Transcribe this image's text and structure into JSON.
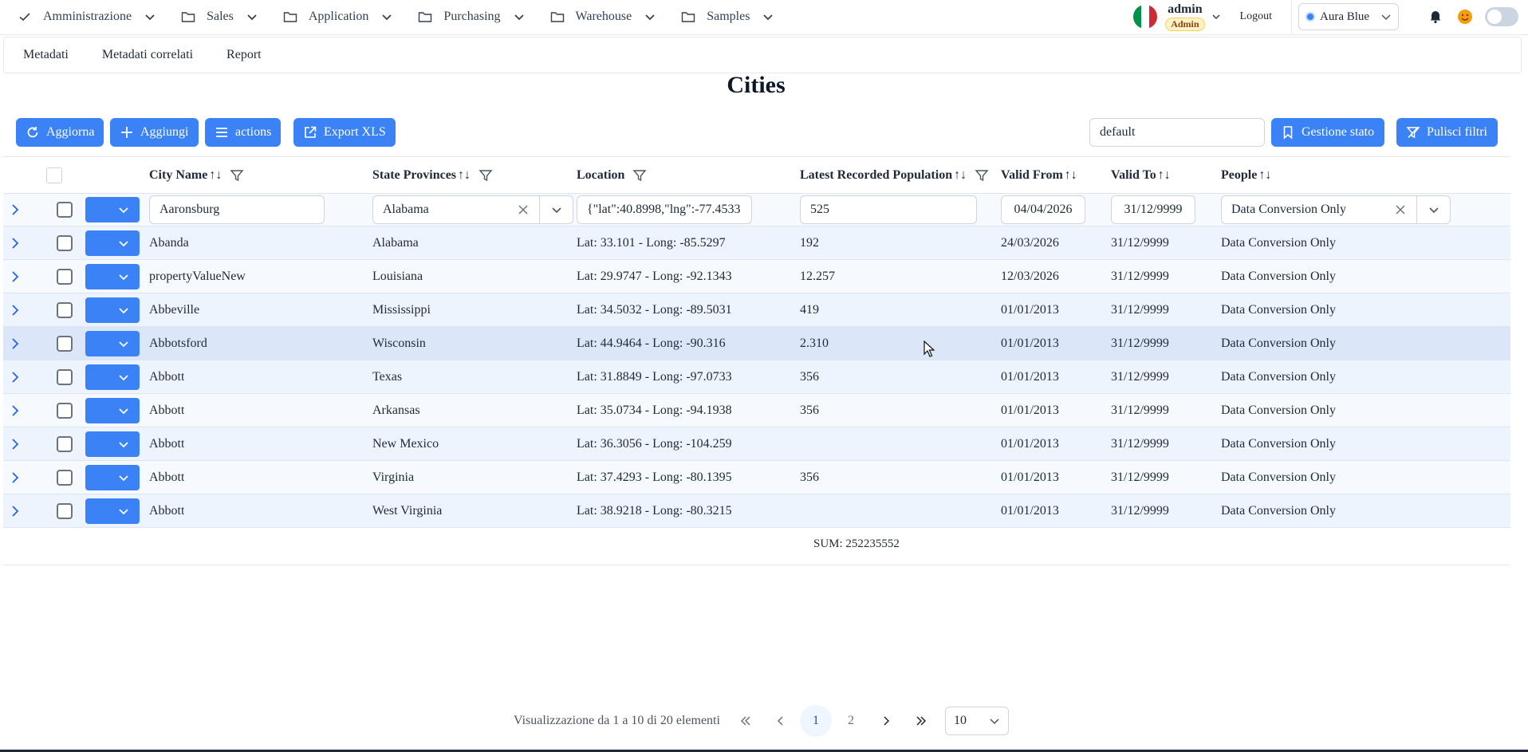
{
  "nav": {
    "items": [
      {
        "label": "Amministrazione",
        "icon": "check-icon"
      },
      {
        "label": "Sales",
        "icon": "folder-icon"
      },
      {
        "label": "Application",
        "icon": "folder-icon"
      },
      {
        "label": "Purchasing",
        "icon": "folder-icon"
      },
      {
        "label": "Warehouse",
        "icon": "folder-icon"
      },
      {
        "label": "Samples",
        "icon": "folder-icon"
      }
    ],
    "user_name": "admin",
    "user_role": "Admin",
    "logout": "Logout",
    "theme": "Aura Blue"
  },
  "subtabs": [
    "Metadati",
    "Metadati correlati",
    "Report"
  ],
  "page_title": "Cities",
  "toolbar": {
    "refresh": "Aggiorna",
    "add": "Aggiungi",
    "actions": "actions",
    "export": "Export XLS",
    "state_value": "default",
    "state_mgmt": "Gestione stato",
    "clear_filters": "Pulisci filtri"
  },
  "table": {
    "columns": {
      "city": "City Name",
      "state": "State Provinces",
      "location": "Location",
      "population": "Latest Recorded Population",
      "valid_from": "Valid From",
      "valid_to": "Valid To",
      "people": "People"
    },
    "sort_icon": "↑↓",
    "filters": {
      "city": "Aaronsburg",
      "state": "Alabama",
      "location": "{\"lat\":40.8998,\"lng\":-77.4533",
      "population": "525",
      "valid_from": "04/04/2026",
      "valid_to": "31/12/9999",
      "people": "Data Conversion Only"
    },
    "rows": [
      {
        "city": "Abanda",
        "state": "Alabama",
        "location": "Lat: 33.101 - Long: -85.5297",
        "population": "192",
        "valid_from": "24/03/2026",
        "valid_to": "31/12/9999",
        "people": "Data Conversion Only"
      },
      {
        "city": "propertyValueNew",
        "state": "Louisiana",
        "location": "Lat: 29.9747 - Long: -92.1343",
        "population": "12.257",
        "valid_from": "12/03/2026",
        "valid_to": "31/12/9999",
        "people": "Data Conversion Only"
      },
      {
        "city": "Abbeville",
        "state": "Mississippi",
        "location": "Lat: 34.5032 - Long: -89.5031",
        "population": "419",
        "valid_from": "01/01/2013",
        "valid_to": "31/12/9999",
        "people": "Data Conversion Only"
      },
      {
        "city": "Abbotsford",
        "state": "Wisconsin",
        "location": "Lat: 44.9464 - Long: -90.316",
        "population": "2.310",
        "valid_from": "01/01/2013",
        "valid_to": "31/12/9999",
        "people": "Data Conversion Only"
      },
      {
        "city": "Abbott",
        "state": "Texas",
        "location": "Lat: 31.8849 - Long: -97.0733",
        "population": "356",
        "valid_from": "01/01/2013",
        "valid_to": "31/12/9999",
        "people": "Data Conversion Only"
      },
      {
        "city": "Abbott",
        "state": "Arkansas",
        "location": "Lat: 35.0734 - Long: -94.1938",
        "population": "356",
        "valid_from": "01/01/2013",
        "valid_to": "31/12/9999",
        "people": "Data Conversion Only"
      },
      {
        "city": "Abbott",
        "state": "New Mexico",
        "location": "Lat: 36.3056 - Long: -104.259",
        "population": "",
        "valid_from": "01/01/2013",
        "valid_to": "31/12/9999",
        "people": "Data Conversion Only"
      },
      {
        "city": "Abbott",
        "state": "Virginia",
        "location": "Lat: 37.4293 - Long: -80.1395",
        "population": "356",
        "valid_from": "01/01/2013",
        "valid_to": "31/12/9999",
        "people": "Data Conversion Only"
      },
      {
        "city": "Abbott",
        "state": "West Virginia",
        "location": "Lat: 38.9218 - Long: -80.3215",
        "population": "",
        "valid_from": "01/01/2013",
        "valid_to": "31/12/9999",
        "people": "Data Conversion Only"
      }
    ],
    "sum": "SUM: 252235552"
  },
  "pager": {
    "summary": "Visualizzazione da 1 a 10 di 20 elementi",
    "pages": [
      "1",
      "2"
    ],
    "current": "1",
    "rows_per_page": "10"
  },
  "colors": {
    "primary": "#3b82f6",
    "row_alt": "#eef4fd",
    "row": "#f6f9fe",
    "row_hover": "#dbe7f9"
  }
}
